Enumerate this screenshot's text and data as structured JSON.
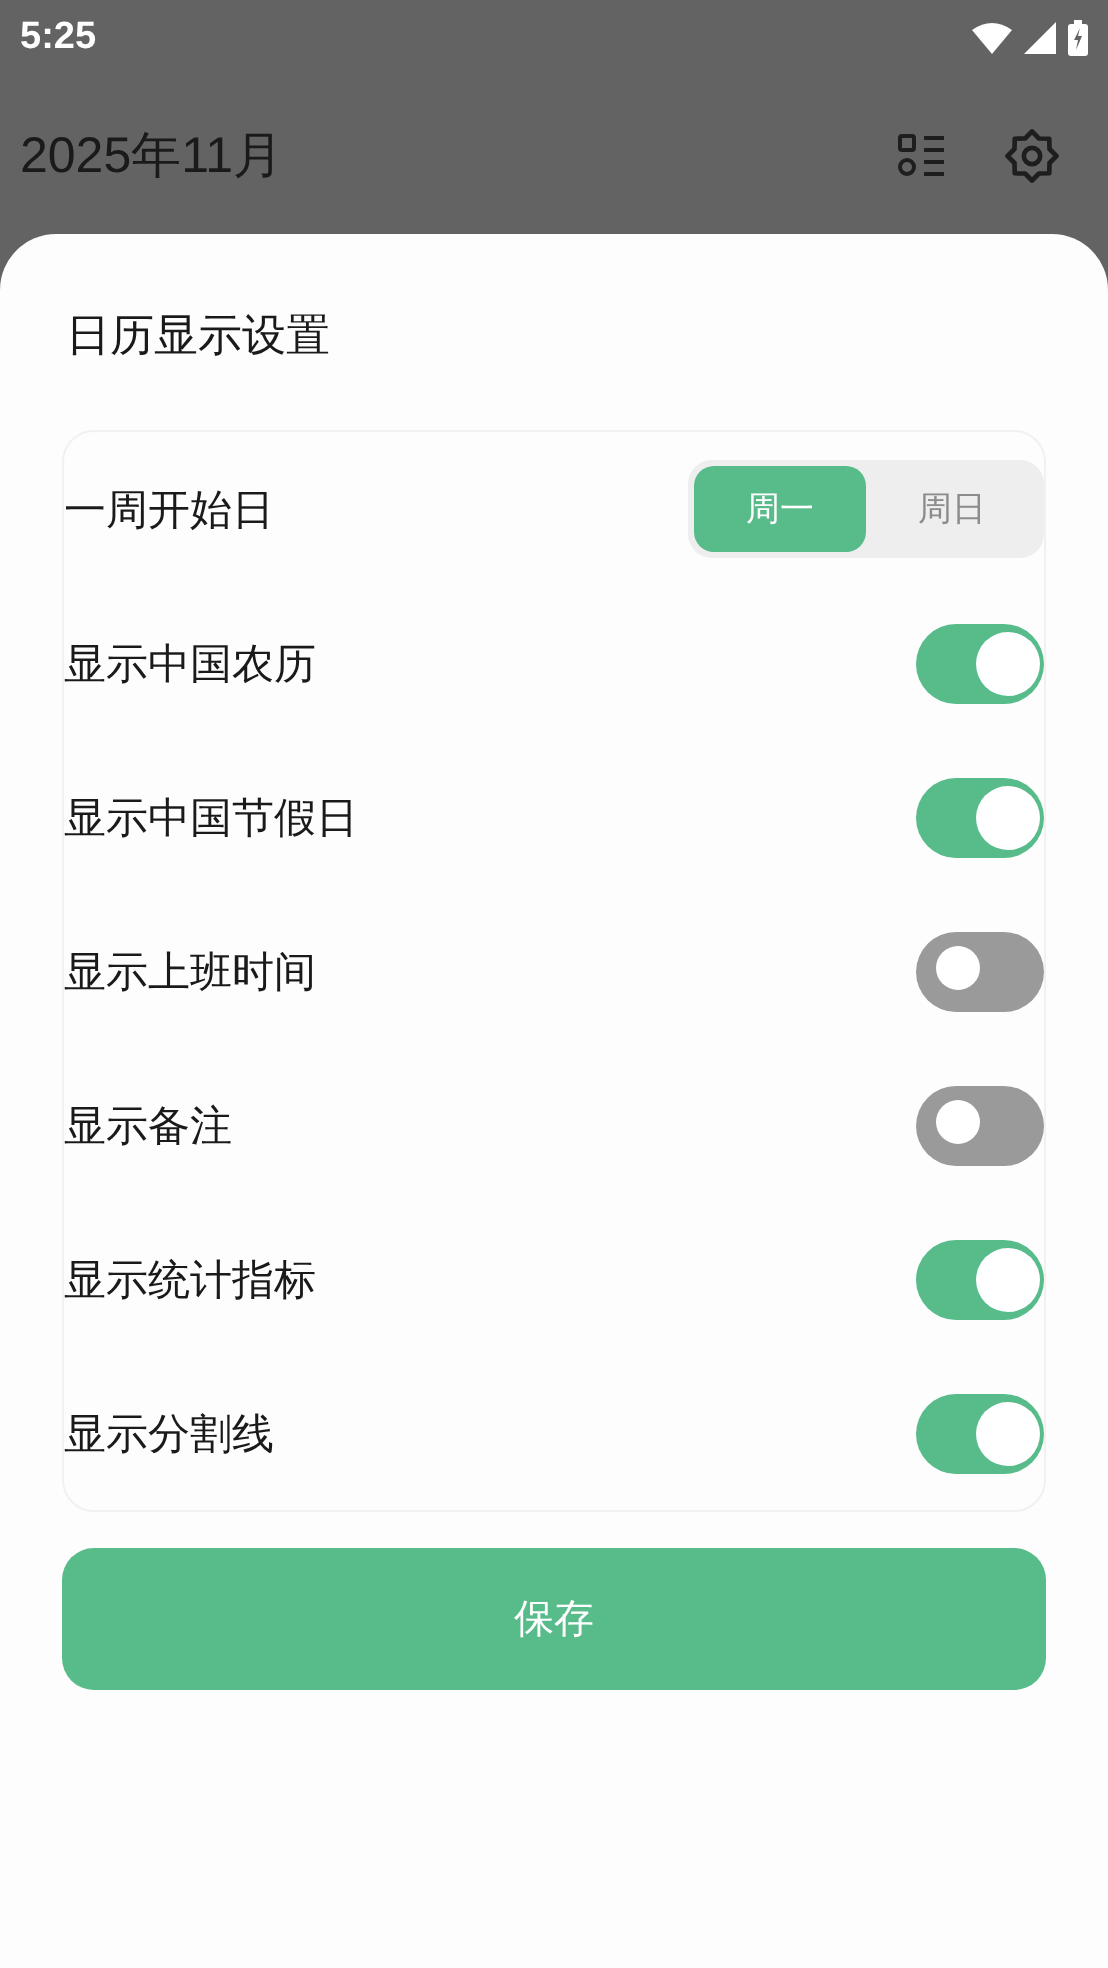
{
  "status_bar": {
    "time": "5:25"
  },
  "app_bar": {
    "title": "2025年11月"
  },
  "sheet": {
    "title": "日历显示设置",
    "settings": [
      {
        "kind": "segment",
        "label": "一周开始日",
        "options": [
          {
            "label": "周一",
            "selected": true
          },
          {
            "label": "周日",
            "selected": false
          }
        ]
      },
      {
        "kind": "toggle",
        "label": "显示中国农历",
        "on": true
      },
      {
        "kind": "toggle",
        "label": "显示中国节假日",
        "on": true
      },
      {
        "kind": "toggle",
        "label": "显示上班时间",
        "on": false
      },
      {
        "kind": "toggle",
        "label": "显示备注",
        "on": false
      },
      {
        "kind": "toggle",
        "label": "显示统计指标",
        "on": true
      },
      {
        "kind": "toggle",
        "label": "显示分割线",
        "on": true
      }
    ],
    "save_button": "保存"
  }
}
